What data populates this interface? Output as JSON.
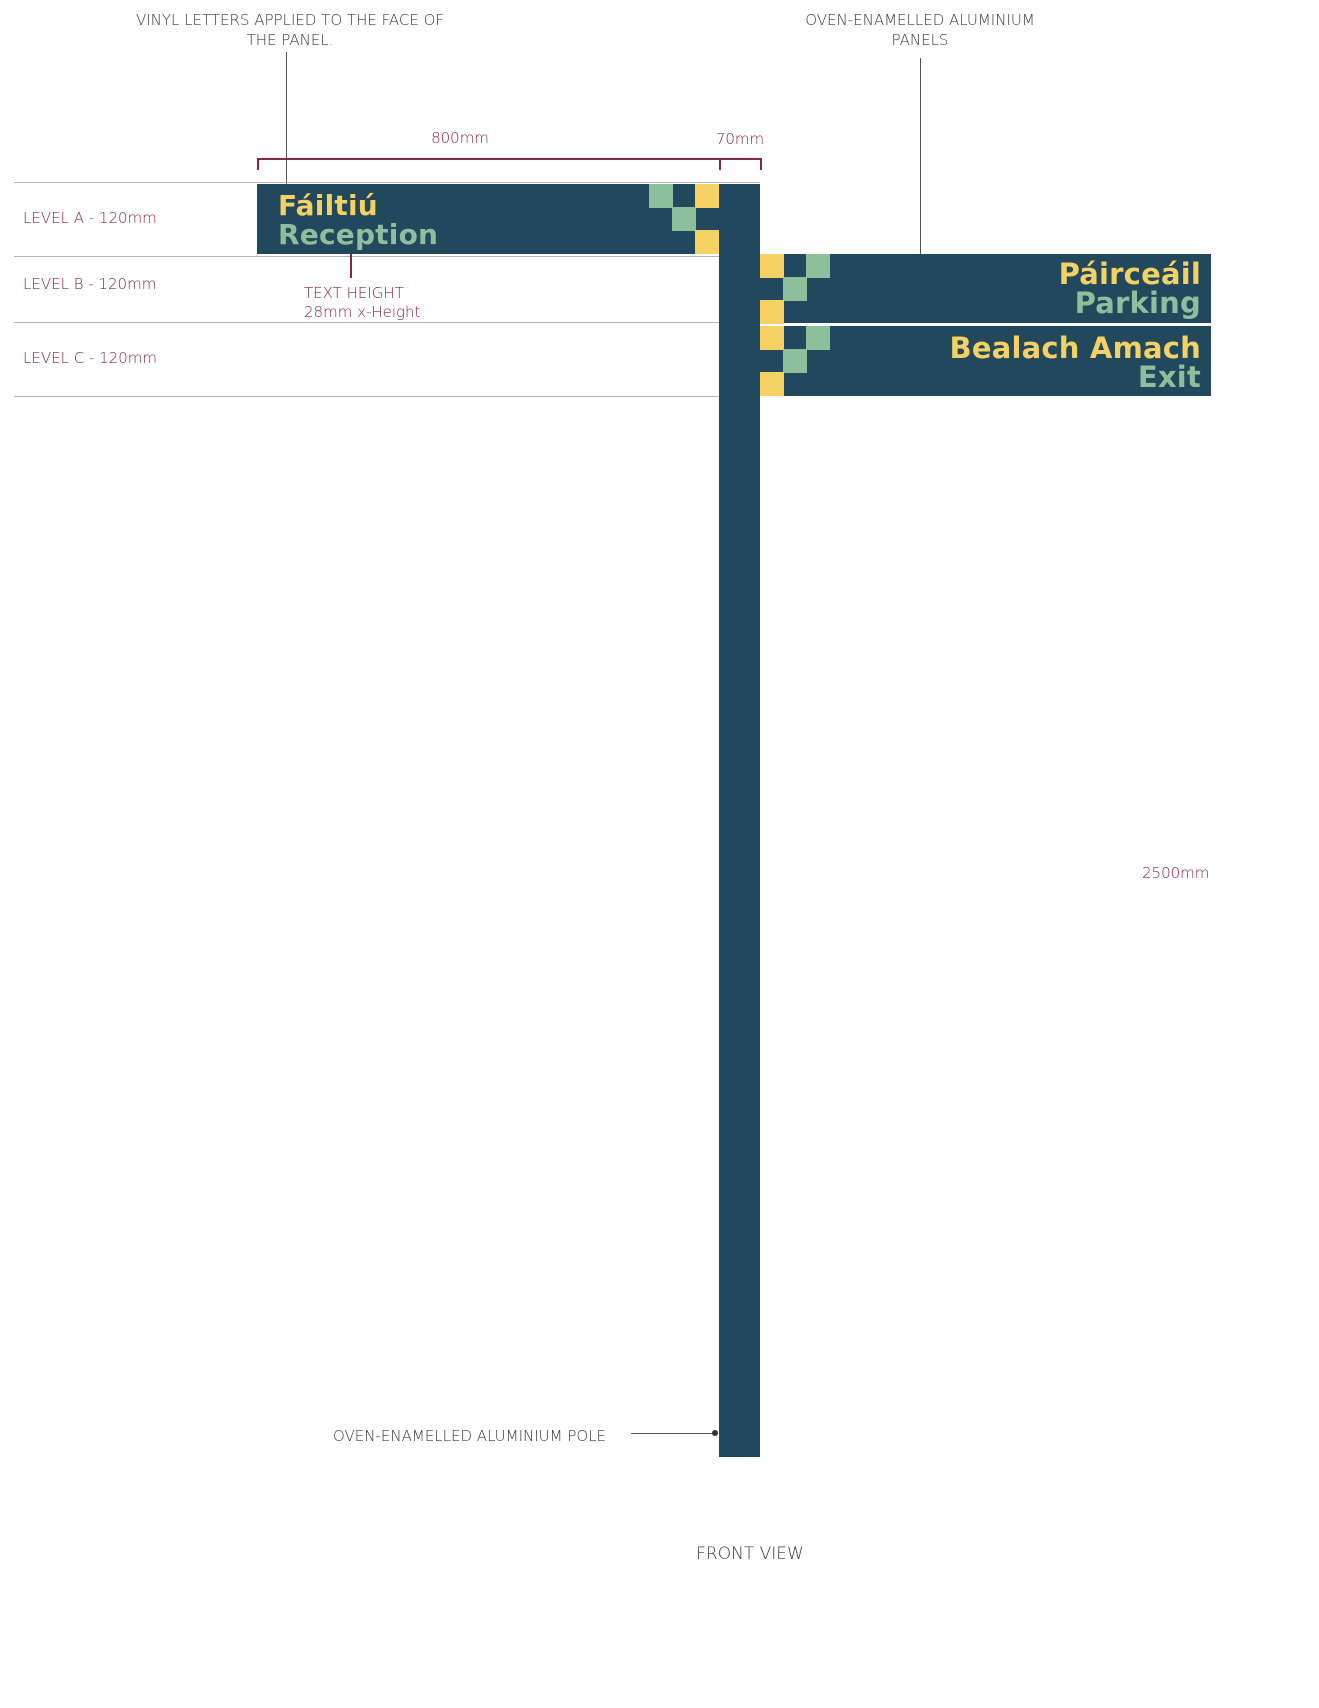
{
  "annotations": {
    "vinyl_letters": "VINYL LETTERS APPLIED TO THE FACE OF THE PANEL.",
    "panels": "OVEN-ENAMELLED ALUMINIUM PANELS",
    "pole": "OVEN-ENAMELLED ALUMINIUM  POLE",
    "text_height_line1": "TEXT HEIGHT",
    "text_height_line2": "28mm x-Height",
    "view": "FRONT VIEW"
  },
  "dimensions": {
    "panel_width": "800mm",
    "pole_width": "70mm",
    "total_height": "2500mm"
  },
  "levels": [
    {
      "label": "LEVEL A - 120mm"
    },
    {
      "label": "LEVEL B - 120mm"
    },
    {
      "label": "LEVEL C - 120mm"
    }
  ],
  "signs": [
    {
      "irish": "Fáiltiú",
      "english": "Reception"
    },
    {
      "irish": "Páirceáil",
      "english": "Parking"
    },
    {
      "irish": "Bealach Amach",
      "english": "Exit"
    }
  ],
  "colors": {
    "panel": "#21485c",
    "yellow": "#f5d164",
    "green": "#8dbf9d",
    "dimension": "#8a2540"
  }
}
